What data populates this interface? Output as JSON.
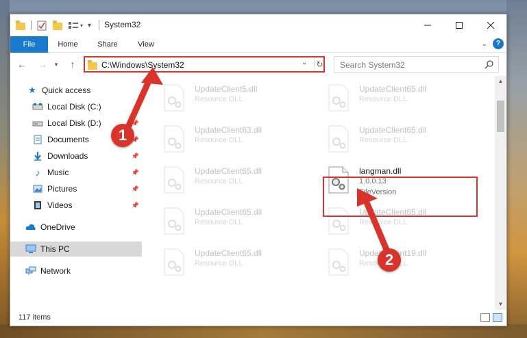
{
  "window": {
    "title": "System32",
    "tabs": {
      "file": "File",
      "home": "Home",
      "share": "Share",
      "view": "View"
    }
  },
  "address": {
    "path": "C:\\Windows\\System32",
    "search_placeholder": "Search System32"
  },
  "nav": {
    "quick_access": "Quick access",
    "items": [
      {
        "label": "Local Disk (C:)",
        "icon": "drive-icon",
        "pinned": false
      },
      {
        "label": "Local Disk (D:)",
        "icon": "drive-icon",
        "pinned": true
      },
      {
        "label": "Documents",
        "icon": "documents-icon",
        "pinned": true
      },
      {
        "label": "Downloads",
        "icon": "downloads-icon",
        "pinned": true
      },
      {
        "label": "Music",
        "icon": "music-icon",
        "pinned": true
      },
      {
        "label": "Pictures",
        "icon": "pictures-icon",
        "pinned": true
      },
      {
        "label": "Videos",
        "icon": "videos-icon",
        "pinned": true
      }
    ],
    "onedrive": "OneDrive",
    "this_pc": "This PC",
    "network": "Network"
  },
  "files": [
    {
      "name": "UpdateClient5.dll",
      "desc": "Resource DLL",
      "faded": true
    },
    {
      "name": "UpdateClient65.dll",
      "desc": "Resource DLL",
      "faded": true
    },
    {
      "name": "UpdateClient63.dll",
      "desc": "Resource DLL",
      "faded": true
    },
    {
      "name": "UpdateClient65.dll",
      "desc": "Resource DLL",
      "faded": true
    },
    {
      "name": "UpdateClient65.dll",
      "desc": "Resource DLL",
      "faded": true
    },
    {
      "name": "langman.dll",
      "desc": "1.0.0.13",
      "desc2": "FileVersion",
      "faded": false
    },
    {
      "name": "UpdateClient65.dll",
      "desc": "Resource DLL",
      "faded": true
    },
    {
      "name": "UpdateClient65.dll",
      "desc": "Resource DLL",
      "faded": true
    },
    {
      "name": "UpdateClient65.dll",
      "desc": "Resource DLL",
      "faded": true
    },
    {
      "name": "UpdateClient19.dll",
      "desc": "Resource DLL",
      "faded": true
    }
  ],
  "status": {
    "item_count": "117 items"
  },
  "callouts": {
    "one": "1",
    "two": "2"
  },
  "colors": {
    "accent": "#1979ca",
    "highlight": "#d9342b"
  }
}
